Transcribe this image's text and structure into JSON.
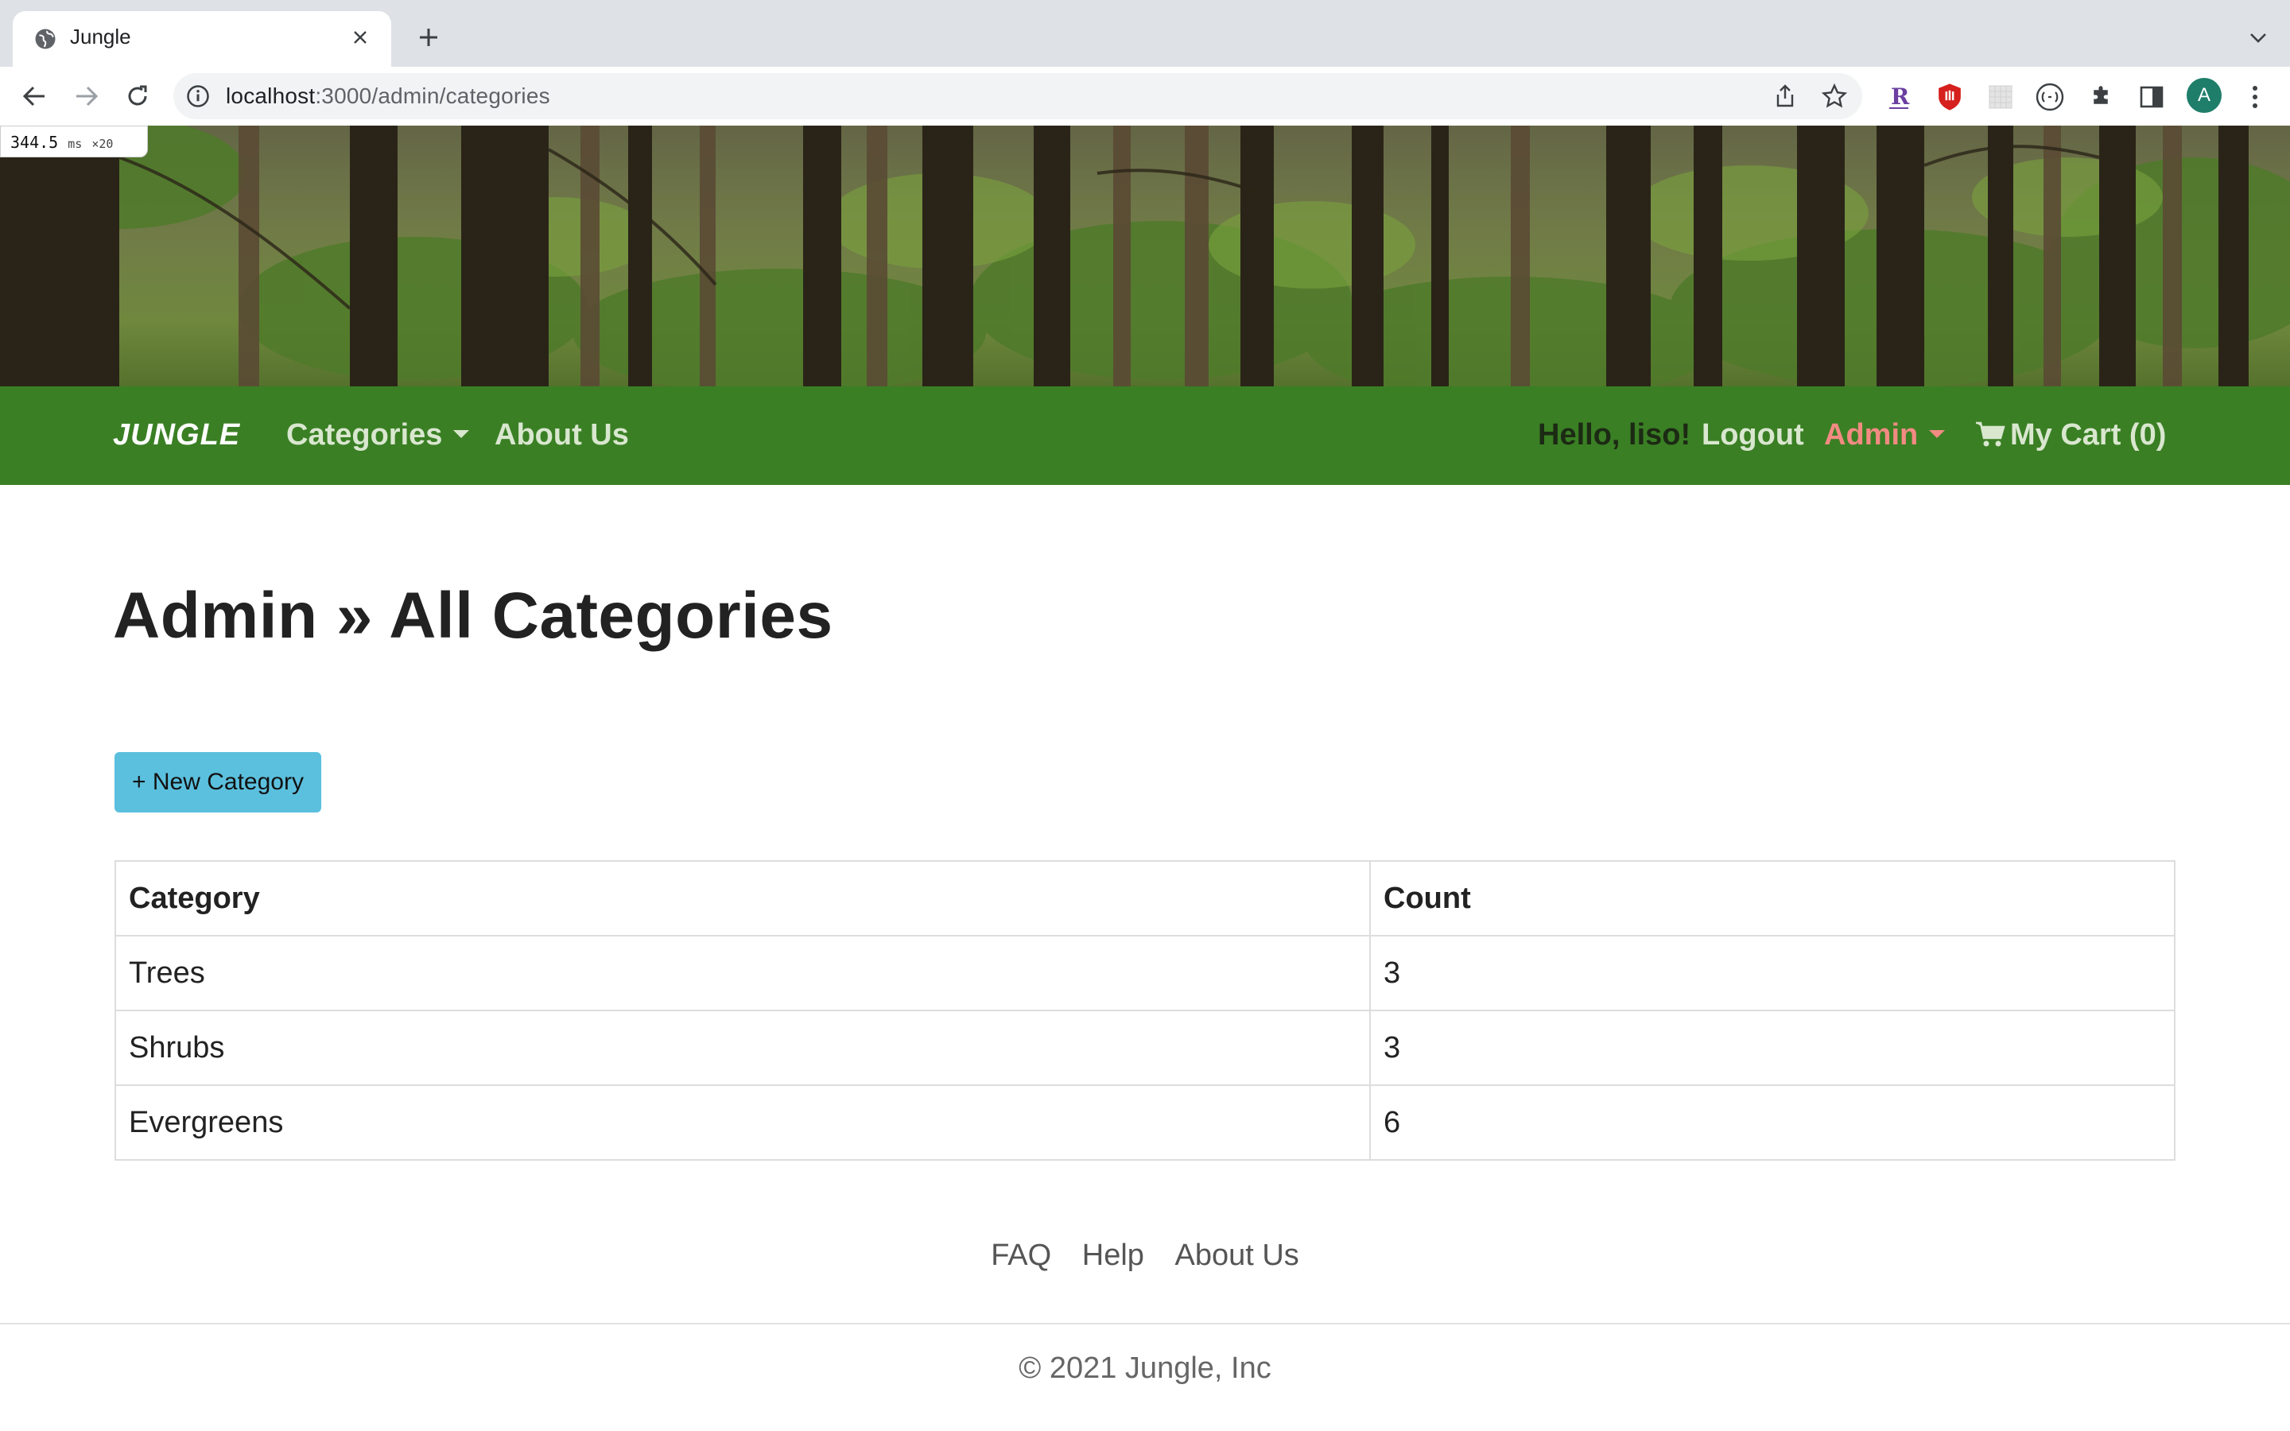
{
  "browser": {
    "tab_title": "Jungle",
    "url_host": "localhost",
    "url_path": ":3000/admin/categories",
    "avatar_letter": "A",
    "perf_value": "344.5",
    "perf_unit": "ms",
    "perf_mult": "×20"
  },
  "navbar": {
    "brand": "JUNGLE",
    "categories": "Categories",
    "about": "About Us",
    "hello": "Hello, liso!",
    "logout": "Logout",
    "admin": "Admin",
    "cart": "My Cart (0)",
    "colors": {
      "bg": "#3a7f24",
      "admin": "#f28b82"
    }
  },
  "page": {
    "title": "Admin » All Categories",
    "new_button": "+ New Category",
    "button_color": "#5bc0de"
  },
  "table": {
    "headers": [
      "Category",
      "Count"
    ],
    "rows": [
      {
        "category": "Trees",
        "count": "3"
      },
      {
        "category": "Shrubs",
        "count": "3"
      },
      {
        "category": "Evergreens",
        "count": "6"
      }
    ]
  },
  "footer": {
    "links": [
      "FAQ",
      "Help",
      "About Us"
    ],
    "copyright": "© 2021 Jungle, Inc"
  }
}
